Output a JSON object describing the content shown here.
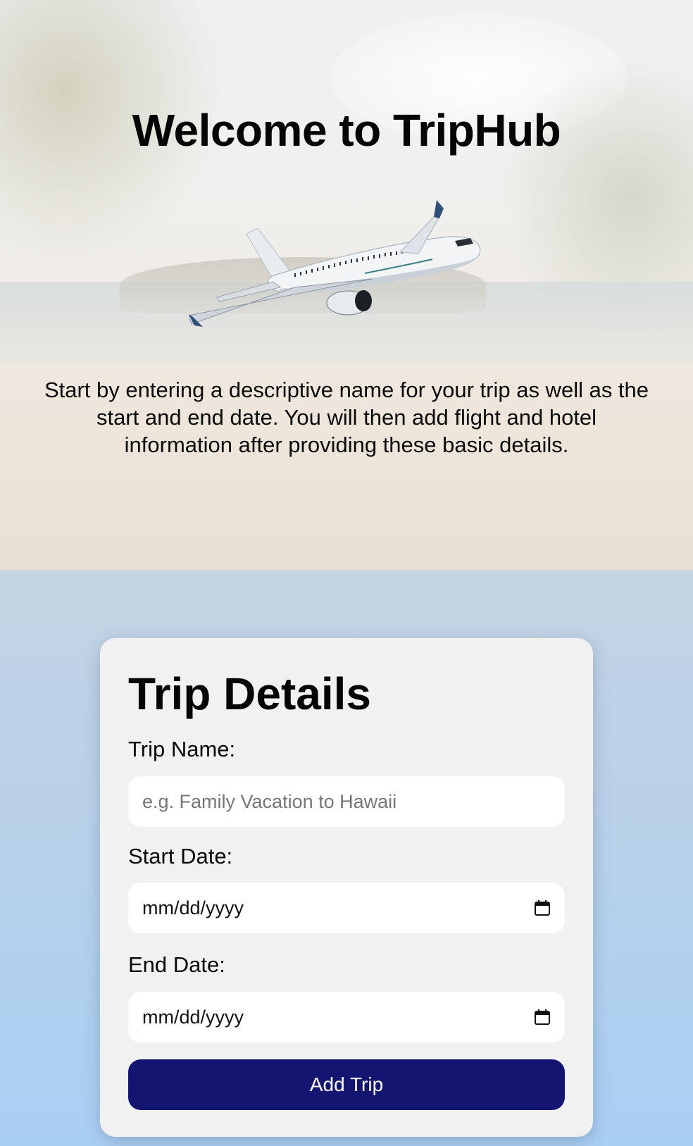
{
  "hero": {
    "title": "Welcome to TripHub",
    "intro": "Start by entering a descriptive name for your trip as well as the start and end date. You will then add flight and hotel information after providing these basic details."
  },
  "form": {
    "title": "Trip Details",
    "trip_name_label": "Trip Name:",
    "trip_name_placeholder": "e.g. Family Vacation to Hawaii",
    "start_date_label": "Start Date:",
    "start_date_value": "mm/dd/yyyy",
    "end_date_label": "End Date:",
    "end_date_value": "mm/dd/yyyy",
    "submit_label": "Add Trip"
  },
  "icons": {
    "calendar": "calendar-icon",
    "airplane": "airplane-illustration"
  },
  "colors": {
    "button": "#141471",
    "card": "#f1f1f1",
    "input": "#ffffff"
  }
}
